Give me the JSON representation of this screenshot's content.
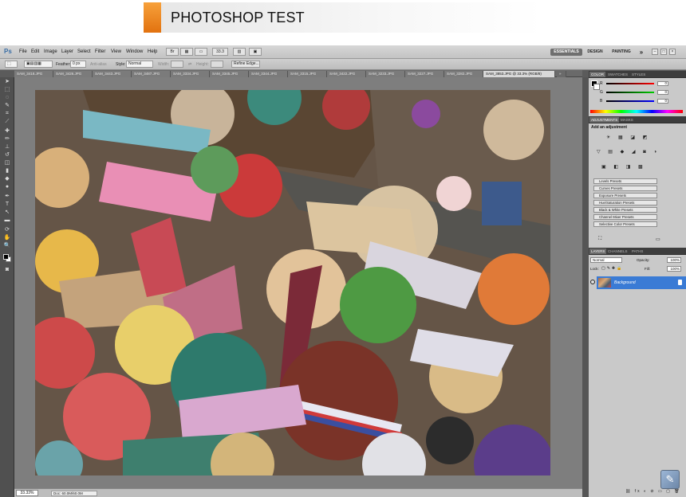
{
  "banner": {
    "title": "PHOTOSHOP TEST",
    "accent_color": "#f08a24"
  },
  "app": {
    "logo": "Ps",
    "menu": [
      "File",
      "Edit",
      "Image",
      "Layer",
      "Select",
      "Filter",
      "View",
      "Window",
      "Help"
    ],
    "zoom_dropdown": "33.3",
    "workspaces": [
      "ESSENTIALS",
      "DESIGN",
      "PAINTING"
    ],
    "workspace_more": "»",
    "window_controls": [
      "–",
      "□",
      "×"
    ]
  },
  "options_bar": {
    "feather_label": "Feather:",
    "feather_value": "0 px",
    "antialias": "Anti-alias",
    "style_label": "Style:",
    "style_value": "Normal",
    "width_label": "Width:",
    "height_label": "Height:",
    "refine_edge": "Refine Edge..."
  },
  "tabs": [
    {
      "label": "SAM_3418.JPG",
      "active": false
    },
    {
      "label": "SAM_3426.JPG",
      "active": false
    },
    {
      "label": "SAM_3443.JPG",
      "active": false
    },
    {
      "label": "SAM_3487.JPG",
      "active": false
    },
    {
      "label": "SAM_3334.JPG",
      "active": false
    },
    {
      "label": "SAM_3345.JPG",
      "active": false
    },
    {
      "label": "SAM_3344.JPG",
      "active": false
    },
    {
      "label": "SAM_3315.JPG",
      "active": false
    },
    {
      "label": "SAM_3422.JPG",
      "active": false
    },
    {
      "label": "SAM_3233.JPG",
      "active": false
    },
    {
      "label": "SAM_3227.JPG",
      "active": false
    },
    {
      "label": "SAM_3282.JPG",
      "active": false
    },
    {
      "label": "SAM_3853.JPG @ 33.3% (RGB/8)",
      "active": true
    }
  ],
  "status": {
    "zoom": "33.33%",
    "doc": "Doc: 60.0M/60.0M"
  },
  "color_panel": {
    "tabs": [
      "COLOR",
      "SWATCHES",
      "STYLES"
    ],
    "channels": [
      {
        "label": "R",
        "value": "0",
        "color": "#d23030"
      },
      {
        "label": "G",
        "value": "0",
        "color": "#2ea845"
      },
      {
        "label": "B",
        "value": "0",
        "color": "#3050d0"
      }
    ]
  },
  "adjustments_panel": {
    "tabs": [
      "ADJUSTMENTS",
      "MASKS"
    ],
    "heading": "Add an adjustment",
    "icon_row1": "☀ ▦ ◪ ◩",
    "icon_row2": "▽ ▤ ◆ ◢ ◙ ◑",
    "icon_row3": "▣ ◧ ◨ ▩",
    "presets": [
      "Levels Presets",
      "Curves Presets",
      "Exposure Presets",
      "Hue/Saturation Presets",
      "Black & White Presets",
      "Channel Mixer Presets",
      "Selective Color Presets"
    ]
  },
  "layers_panel": {
    "tabs": [
      "LAYERS",
      "CHANNELS",
      "PATHS"
    ],
    "blend_mode": "Normal",
    "opacity_label": "Opacity:",
    "opacity_value": "100%",
    "lock_label": "Lock:",
    "fill_label": "Fill:",
    "fill_value": "100%",
    "layer_name": "Background",
    "footer_icons": "⛓ fx ◐ ⊘ ▭ ▢ 🗑"
  }
}
